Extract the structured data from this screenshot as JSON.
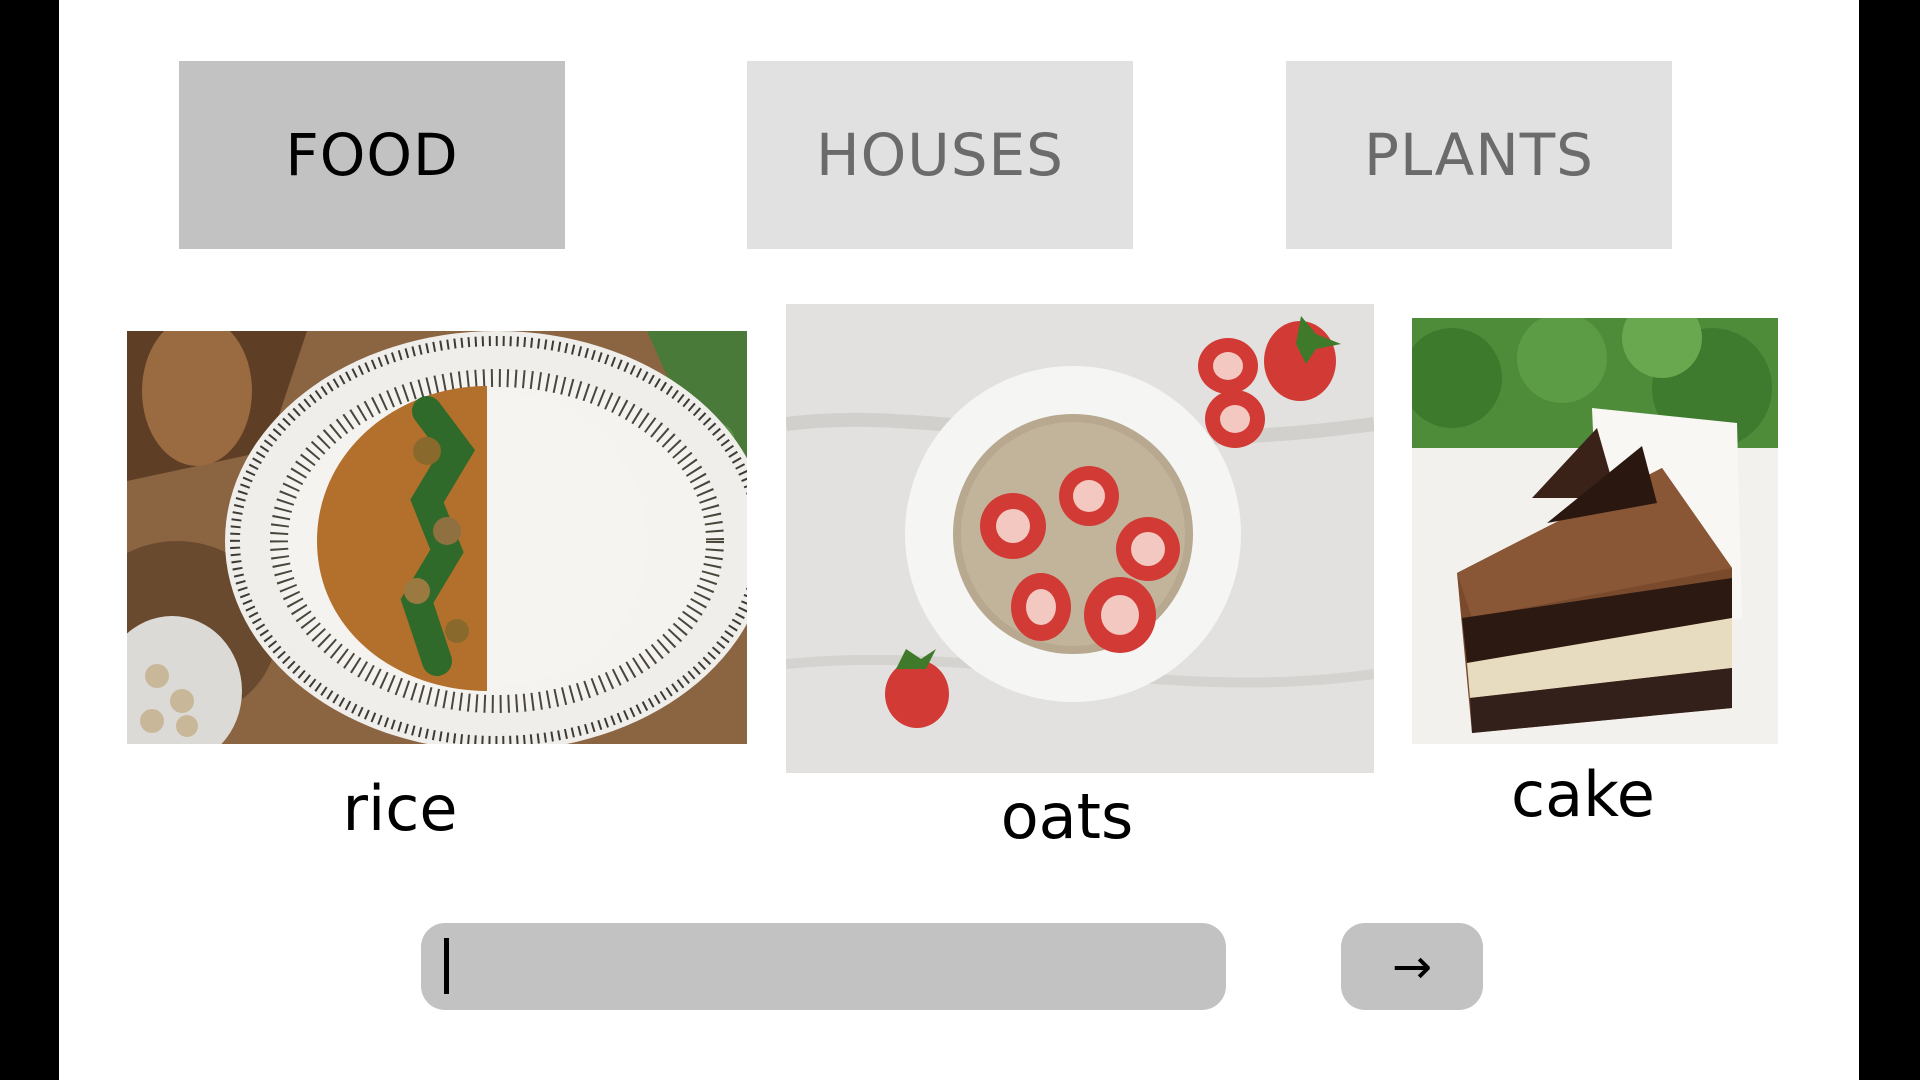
{
  "tabs": [
    {
      "label": "FOOD",
      "active": true
    },
    {
      "label": "HOUSES",
      "active": false
    },
    {
      "label": "PLANTS",
      "active": false
    }
  ],
  "cards": [
    {
      "caption": "rice",
      "image": "curry-rice-bowl"
    },
    {
      "caption": "oats",
      "image": "oatmeal-strawberries"
    },
    {
      "caption": "cake",
      "image": "chocolate-cake-slice"
    }
  ],
  "search": {
    "value": "",
    "placeholder": ""
  },
  "submit": {
    "label": "→",
    "icon": "arrow-right-icon"
  },
  "colors": {
    "active_tab": "#c2c2c2",
    "inactive_tab": "#e1e1e1",
    "inactive_text": "#6b6b6b",
    "input_bg": "#c2c2c2"
  }
}
